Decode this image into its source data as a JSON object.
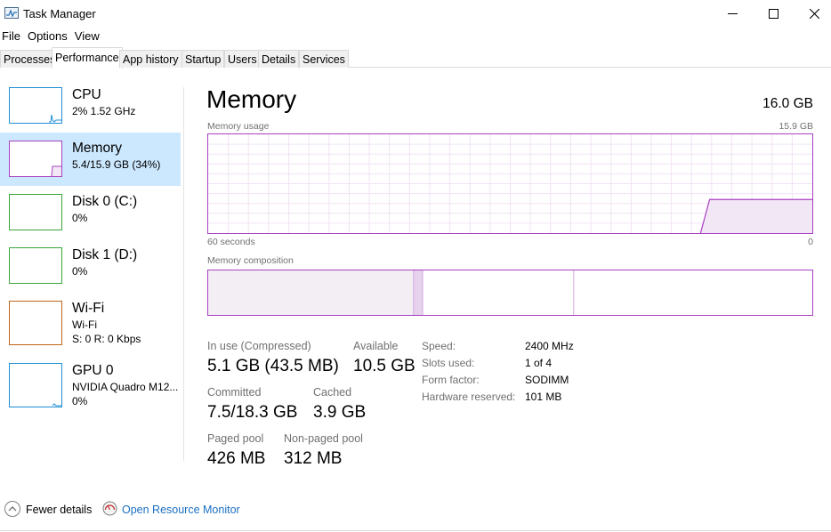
{
  "window": {
    "title": "Task Manager",
    "icons": {
      "app": "task-manager-icon",
      "minimize": "minimize-icon",
      "maximize": "maximize-icon",
      "close": "close-icon"
    }
  },
  "menu": [
    "File",
    "Options",
    "View"
  ],
  "tabs": [
    "Processes",
    "Performance",
    "App history",
    "Startup",
    "Users",
    "Details",
    "Services"
  ],
  "active_tab": "Performance",
  "sidebar": {
    "items": [
      {
        "title": "CPU",
        "line1": "2%  1.52 GHz",
        "line2": "",
        "color": "#1f8fd6"
      },
      {
        "title": "Memory",
        "line1": "5.4/15.9 GB (34%)",
        "line2": "",
        "color": "#a93fc2",
        "selected": true
      },
      {
        "title": "Disk 0 (C:)",
        "line1": "0%",
        "line2": "",
        "color": "#3aa63a"
      },
      {
        "title": "Disk 1 (D:)",
        "line1": "0%",
        "line2": "",
        "color": "#3aa63a"
      },
      {
        "title": "Wi-Fi",
        "line1": "Wi-Fi",
        "line2": "S: 0  R: 0 Kbps",
        "color": "#c0661c"
      },
      {
        "title": "GPU 0",
        "line1": "NVIDIA Quadro M12...",
        "line2": "0%",
        "color": "#1f8fd6"
      }
    ]
  },
  "main": {
    "title": "Memory",
    "total": "16.0 GB",
    "usage_label": "Memory usage",
    "usage_max": "15.9 GB",
    "time_left": "60 seconds",
    "time_right": "0",
    "composition_label": "Memory composition",
    "usage_level": 0.34,
    "composition": {
      "in_use_fraction": 0.34,
      "modified_fraction": 0.015,
      "standby_fraction": 0.25
    },
    "accent": "#a93fc2",
    "stats": {
      "in_use_label": "In use (Compressed)",
      "in_use_value": "5.1 GB (43.5 MB)",
      "available_label": "Available",
      "available_value": "10.5 GB",
      "committed_label": "Committed",
      "committed_value": "7.5/18.3 GB",
      "cached_label": "Cached",
      "cached_value": "3.9 GB",
      "paged_label": "Paged pool",
      "paged_value": "426 MB",
      "nonpaged_label": "Non-paged pool",
      "nonpaged_value": "312 MB"
    },
    "details": {
      "speed_key": "Speed:",
      "speed_val": "2400 MHz",
      "slots_key": "Slots used:",
      "slots_val": "1 of 4",
      "form_key": "Form factor:",
      "form_val": "SODIMM",
      "hw_key": "Hardware reserved:",
      "hw_val": "101 MB"
    }
  },
  "footer": {
    "fewer_details": "Fewer details",
    "open_monitor": "Open Resource Monitor"
  }
}
